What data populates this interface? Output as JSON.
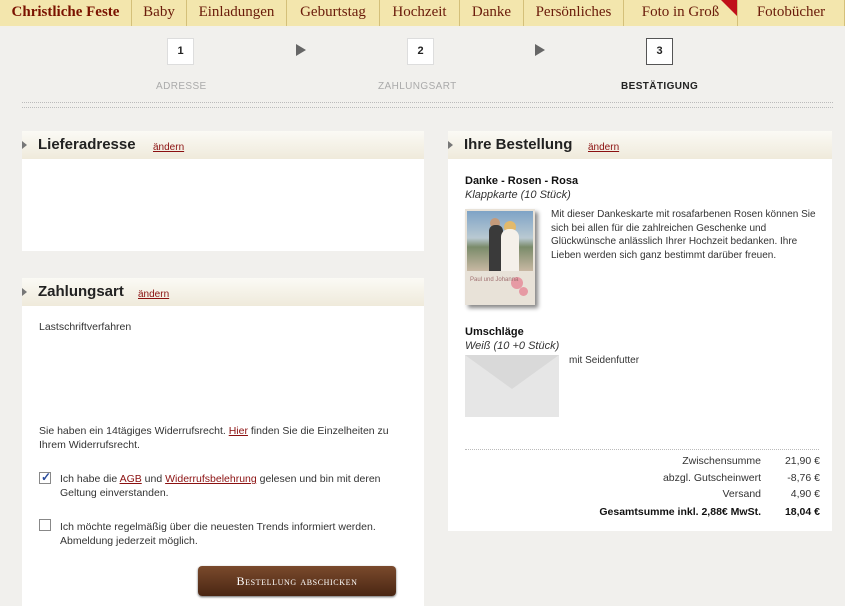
{
  "nav": {
    "tabs": [
      "Christliche Feste",
      "Baby",
      "Einladungen",
      "Geburtstag",
      "Hochzeit",
      "Danke",
      "Persönliches",
      "Foto in Groß",
      "Fotobücher"
    ]
  },
  "steps": [
    {
      "number": "1",
      "label": "ADRESSE"
    },
    {
      "number": "2",
      "label": "ZAHLUNGSART"
    },
    {
      "number": "3",
      "label": "BESTÄTIGUNG"
    }
  ],
  "delivery": {
    "title": "Lieferadresse",
    "change": "ändern"
  },
  "payment": {
    "title": "Zahlungsart",
    "change": "ändern",
    "method": "Lastschriftverfahren",
    "revocation_pre": "Sie haben ein 14tägiges Widerrufsrecht. ",
    "revocation_link": "Hier",
    "revocation_post": " finden Sie die Einzelheiten zu Ihrem Widerrufsrecht.",
    "terms_pre": "Ich habe die ",
    "terms_agb": "AGB",
    "terms_mid": " und ",
    "terms_widerruf": "Widerrufsbelehrung",
    "terms_post": " gelesen und bin mit deren Geltung einverstanden.",
    "terms_checked": true,
    "newsletter": "Ich möchte regelmäßig über die neuesten Trends informiert werden. Abmeldung jederzeit möglich.",
    "newsletter_checked": false,
    "submit": "Bestellung abschicken"
  },
  "order": {
    "title": "Ihre Bestellung",
    "change": "ändern",
    "product_name": "Danke - Rosen - Rosa",
    "product_variant": "Klappkarte (10 Stück)",
    "product_desc": "Mit dieser Dankeskarte mit rosafarbenen Rosen können Sie sich bei allen für die zahlreichen Geschenke und Glückwünsche anlässlich Ihrer Hochzeit bedanken. Ihre Lieben werden sich ganz bestimmt darüber freuen.",
    "card_caption": "Paul und Johanna",
    "envelope_name": "Umschläge",
    "envelope_variant": "Weiß (10 +0 Stück)",
    "envelope_desc": "mit Seidenfutter",
    "summary": [
      {
        "label": "Zwischensumme",
        "value": "21,90 €"
      },
      {
        "label": "abzgl. Gutscheinwert",
        "value": "-8,76 €"
      },
      {
        "label": "Versand",
        "value": "4,90 €"
      }
    ],
    "total_label": "Gesamtsumme inkl. 2,88€ MwSt.",
    "total_value": "18,04 €"
  }
}
